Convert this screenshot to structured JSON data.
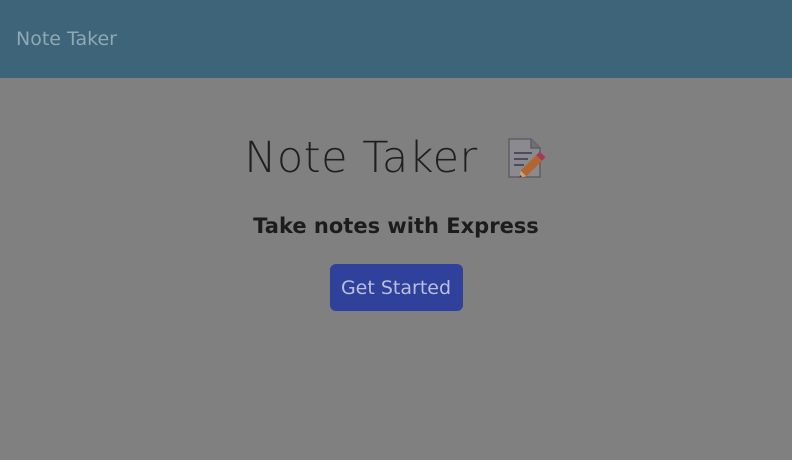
{
  "navbar": {
    "brand": "Note Taker"
  },
  "hero": {
    "title": "Note Taker",
    "icon": "memo-pencil-icon",
    "subtitle": "Take notes with Express",
    "button_label": "Get Started"
  },
  "colors": {
    "navbar_bg": "#3d6479",
    "page_bg": "#808080",
    "button_bg": "#2f419b"
  }
}
